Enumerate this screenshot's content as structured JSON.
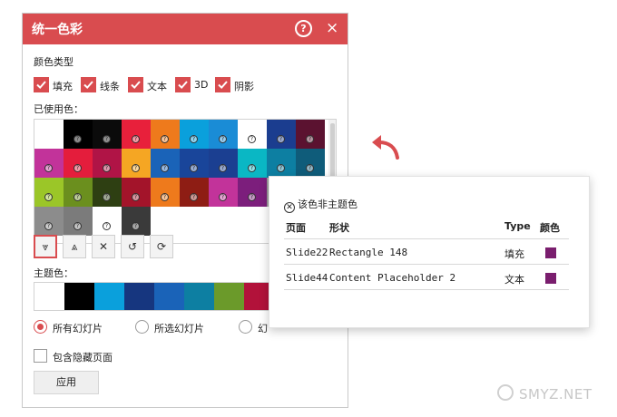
{
  "dialog": {
    "title": "统一色彩",
    "help_glyph": "?",
    "close_glyph": "×",
    "color_type_label": "颜色类型",
    "checkboxes": [
      {
        "label": "填充",
        "checked": true
      },
      {
        "label": "线条",
        "checked": true
      },
      {
        "label": "文本",
        "checked": true
      },
      {
        "label": "3D",
        "checked": true
      },
      {
        "label": "阴影",
        "checked": true
      }
    ],
    "used_colors_label": "已使用色：",
    "used_colors": [
      [
        "#ffffff",
        "#000000",
        "#0b0b0b",
        "#e8203b",
        "#ee7a1c",
        "#0aa0dc",
        "#1a8cd6",
        "#ffffff",
        "#1b3d8f",
        "#5b1230"
      ],
      [
        "#c2339a",
        "#e41d3c",
        "#b01446",
        "#f5a623",
        "#1a63b8",
        "#19459a",
        "#1b3f91",
        "#0ab7c4",
        "#0d7fa2",
        "#0f5c7a"
      ],
      [
        "#9bc628",
        "#6b8f1e",
        "#2e3f12",
        "#a3142a",
        "#ee7a1c",
        "#8e1d14",
        "#c2339a",
        "#7c1e7c",
        "#9e9e9e",
        "#ffffff"
      ],
      [
        "#8c8c8c",
        "#7b7b7b",
        "#ffffff",
        "#3a3a3a"
      ]
    ],
    "used_marks": [
      [
        false,
        true,
        true,
        true,
        true,
        true,
        true,
        true,
        true,
        true
      ],
      [
        true,
        true,
        true,
        true,
        true,
        true,
        true,
        true,
        true,
        true
      ],
      [
        true,
        true,
        true,
        true,
        true,
        true,
        true,
        true,
        true,
        true
      ],
      [
        true,
        true,
        true,
        true
      ]
    ],
    "toolbar": [
      {
        "icon": "expand-down-icon",
        "glyph": "⩔",
        "active": true
      },
      {
        "icon": "collapse-up-icon",
        "glyph": "⩓",
        "active": false
      },
      {
        "icon": "clear-icon",
        "glyph": "✕",
        "active": false
      },
      {
        "icon": "undo-icon",
        "glyph": "↺",
        "active": false
      },
      {
        "icon": "refresh-icon",
        "glyph": "⟳",
        "active": false
      }
    ],
    "theme_colors_label": "主题色：",
    "theme_colors": [
      "#ffffff",
      "#000000",
      "#0aa0dc",
      "#16367f",
      "#1a63b8",
      "#0d7fa2",
      "#6b9a2a",
      "#b2123a"
    ],
    "scope_options": [
      {
        "label": "所有幻灯片",
        "selected": true
      },
      {
        "label": "所选幻灯片",
        "selected": false
      },
      {
        "label": "幻",
        "selected": false
      }
    ],
    "include_hidden_label": "包含隐藏页面",
    "apply_label": "应用"
  },
  "popup": {
    "header": "该色非主题色",
    "columns": [
      "页面",
      "形状",
      "Type",
      "颜色"
    ],
    "rows": [
      {
        "page": "Slide22",
        "shape": "Rectangle 148",
        "type": "填充",
        "color": "#7a1e6e"
      },
      {
        "page": "Slide44",
        "shape": "Content Placeholder 2",
        "type": "文本",
        "color": "#7a1e6e"
      }
    ]
  },
  "colors": {
    "accent": "#d94c4f",
    "arrow": "#d94c4f"
  },
  "watermark": "SMYZ.NET"
}
